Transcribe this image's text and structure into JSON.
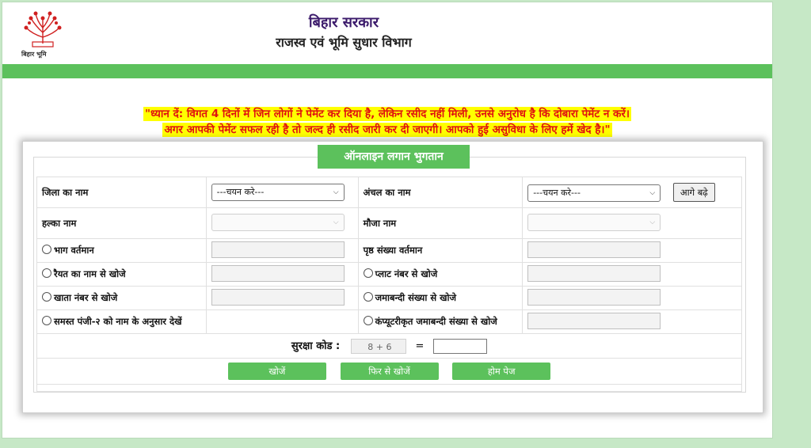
{
  "header": {
    "logo_caption": "बिहार भूमि",
    "gov_title": "बिहार सरकार",
    "dept_title": "राजस्व एवं भूमि सुधार विभाग"
  },
  "notice": {
    "line1": "\"ध्यान दें: विगत 4 दिनों में जिन लोगों ने पेमेंट कर दिया है, लेकिन रसीद नहीं मिली, उनसे अनुरोध है कि दोबारा पेमेंट न करें।",
    "line2": "अगर आपकी पेमेंट सफल रही है तो जल्द ही रसीद जारी कर दी जाएगी। आपको हुई असुविधा के लिए हमें खेद है।\""
  },
  "form": {
    "title": "ऑनलाइन लगान भुगतान",
    "district_label": "जिला का नाम",
    "district_value": "---चयन करे---",
    "circle_label": "अंचल का नाम",
    "circle_value": "---चयन करे---",
    "next_button": "आगे बढ़े",
    "halka_label": "हल्का नाम",
    "mauja_label": "मौजा नाम",
    "radio_bhag": "भाग वर्तमान",
    "page_label": "पृष्ठ संख्या वर्तमान",
    "radio_raiyat": "रैयत का नाम से खोजे",
    "radio_plot": "प्लाट नंबर से खोजे",
    "radio_khata": "खाता नंबर से खोजे",
    "radio_jamabandi": "जमाबन्दी संख्या से खोजे",
    "radio_register": "समस्त पंजी-२ को नाम के अनुसार देखें",
    "radio_computer": "कंप्यूटरीकृत जमाबन्दी संख्या से खोजे",
    "captcha_label": "सुरक्षा कोड :",
    "captcha_question": "8 + 6",
    "captcha_equals": "=",
    "search_button": "खोजें",
    "research_button": "फिर से खोजें",
    "home_button": "होम पेज"
  },
  "colors": {
    "accent_green": "#5cc15c",
    "notice_red": "#e01010",
    "notice_highlight": "#ffff00",
    "title_purple": "#3b1a6b"
  }
}
